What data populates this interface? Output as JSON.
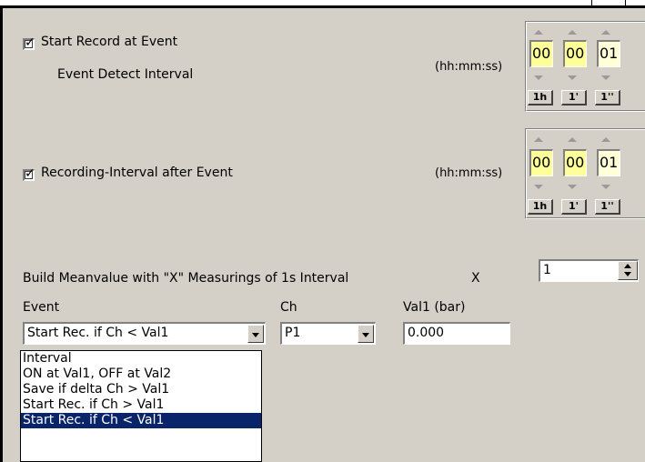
{
  "start_record": {
    "label": "Start Record at Event",
    "checked": true,
    "sublabel": "Event Detect Interval",
    "format": "(hh:mm:ss)",
    "hh": "00",
    "mm": "00",
    "ss": "01",
    "btn_h": "1h",
    "btn_m": "1'",
    "btn_s": "1''"
  },
  "recording_interval": {
    "label": "Recording-Interval after Event",
    "checked": true,
    "format": "(hh:mm:ss)",
    "hh": "00",
    "mm": "00",
    "ss": "01",
    "btn_h": "1h",
    "btn_m": "1'",
    "btn_s": "1''"
  },
  "meanvalue": {
    "label": "Build Meanvalue with \"X\" Measurings of 1s Interval",
    "x_label": "X",
    "value": "1"
  },
  "event": {
    "header": "Event",
    "selected": "Start Rec. if Ch < Val1",
    "options": [
      "Interval",
      "ON at Val1, OFF at Val2",
      "Save if delta Ch > Val1",
      "Start Rec. if Ch > Val1",
      "Start Rec. if Ch < Val1"
    ],
    "highlighted_index": 4
  },
  "channel": {
    "header": "Ch",
    "selected": "P1"
  },
  "val1": {
    "header": "Val1 (bar)",
    "value": "0.000"
  },
  "colors": {
    "panel": "#d4d0c8",
    "time_field": "#ffff99",
    "selection": "#0a246a"
  }
}
